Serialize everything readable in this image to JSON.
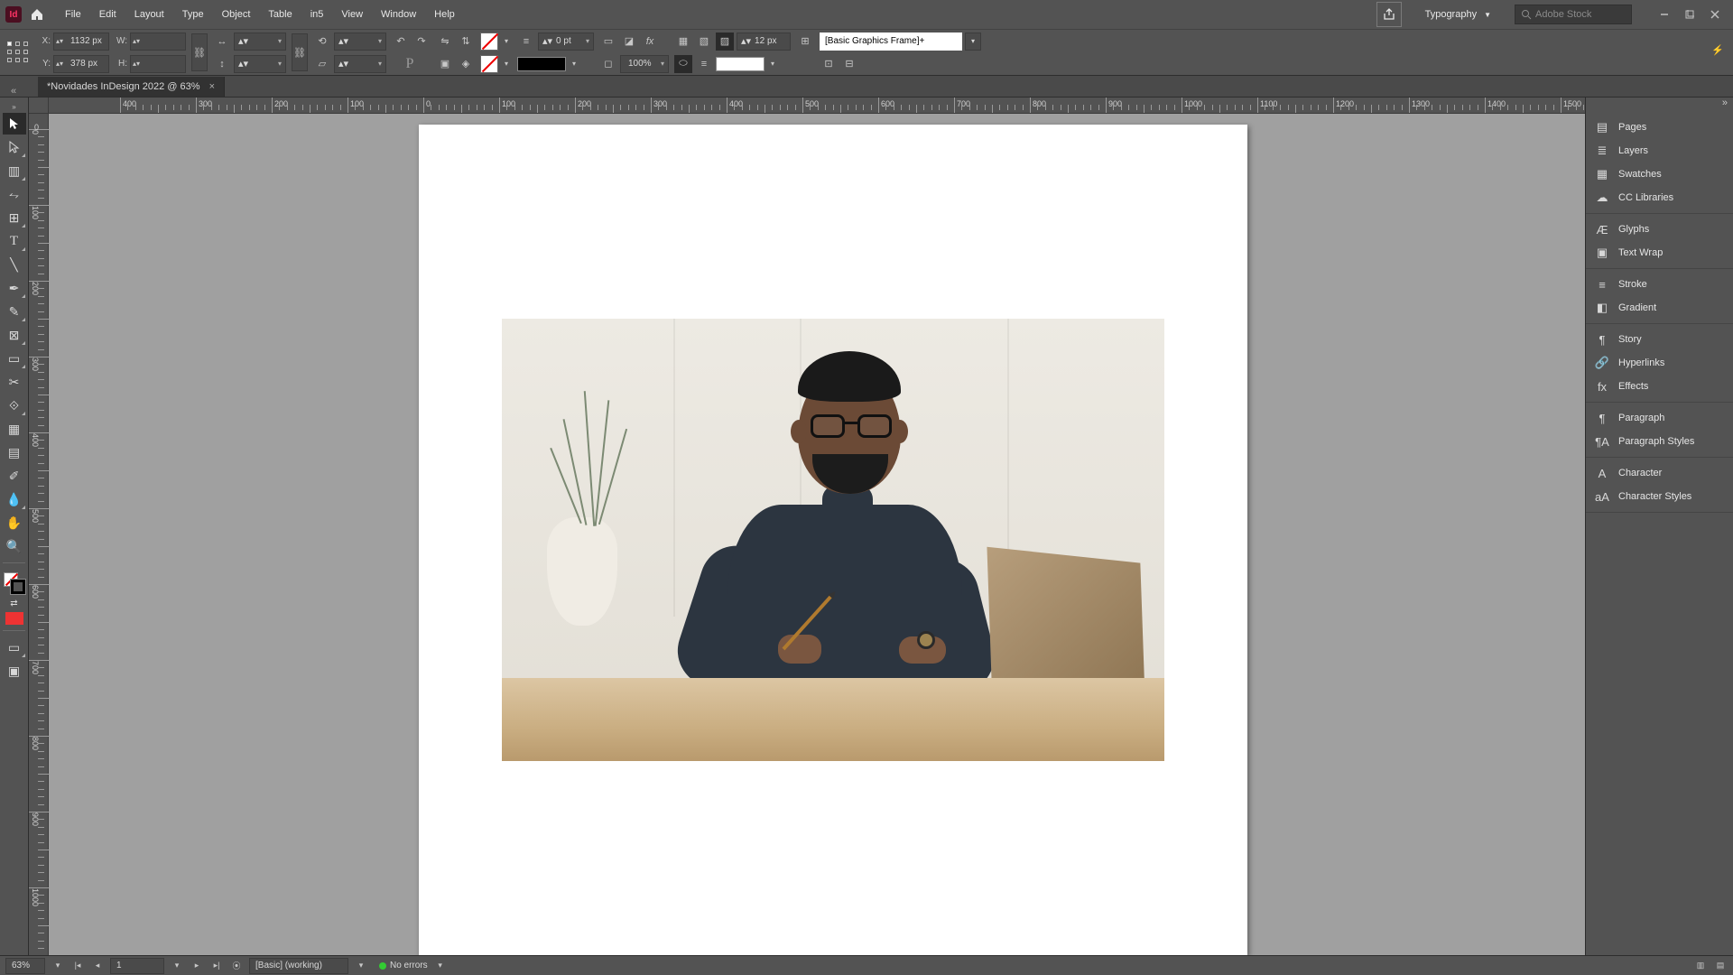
{
  "menu": {
    "items": [
      "File",
      "Edit",
      "Layout",
      "Type",
      "Object",
      "Table",
      "in5",
      "View",
      "Window",
      "Help"
    ],
    "workspace": "Typography",
    "stock_placeholder": "Adobe Stock"
  },
  "control": {
    "x_label": "X:",
    "x_value": "1132 px",
    "y_label": "Y:",
    "y_value": "378 px",
    "w_label": "W:",
    "w_value": "",
    "h_label": "H:",
    "h_value": "",
    "stroke_weight": "0 pt",
    "opacity": "100%",
    "corner": "12 px",
    "style": "[Basic Graphics Frame]+"
  },
  "doc": {
    "tab": "*Novidades InDesign 2022 @ 63%"
  },
  "ruler": {
    "h_ticks": [
      "400",
      "300",
      "200",
      "100",
      "0",
      "100",
      "200",
      "300",
      "400",
      "500",
      "600",
      "700",
      "800",
      "900",
      "1000",
      "1100",
      "1200",
      "1300",
      "1400",
      "1500"
    ],
    "v_ticks": [
      "0",
      "100",
      "200",
      "300",
      "400",
      "500",
      "600",
      "700",
      "800",
      "900",
      "1000"
    ]
  },
  "panels": {
    "groups": [
      [
        {
          "icon": "pages",
          "label": "Pages"
        },
        {
          "icon": "layers",
          "label": "Layers"
        },
        {
          "icon": "swatches",
          "label": "Swatches"
        },
        {
          "icon": "cc",
          "label": "CC Libraries"
        }
      ],
      [
        {
          "icon": "glyphs",
          "label": "Glyphs"
        },
        {
          "icon": "wrap",
          "label": "Text Wrap"
        }
      ],
      [
        {
          "icon": "stroke",
          "label": "Stroke"
        },
        {
          "icon": "gradient",
          "label": "Gradient"
        }
      ],
      [
        {
          "icon": "story",
          "label": "Story"
        },
        {
          "icon": "hyperlinks",
          "label": "Hyperlinks"
        },
        {
          "icon": "effects",
          "label": "Effects"
        }
      ],
      [
        {
          "icon": "paragraph",
          "label": "Paragraph"
        },
        {
          "icon": "pstyles",
          "label": "Paragraph Styles"
        }
      ],
      [
        {
          "icon": "character",
          "label": "Character"
        },
        {
          "icon": "cstyles",
          "label": "Character Styles"
        }
      ]
    ]
  },
  "status": {
    "zoom": "63%",
    "page": "1",
    "profile": "[Basic] (working)",
    "errors": "No errors"
  }
}
